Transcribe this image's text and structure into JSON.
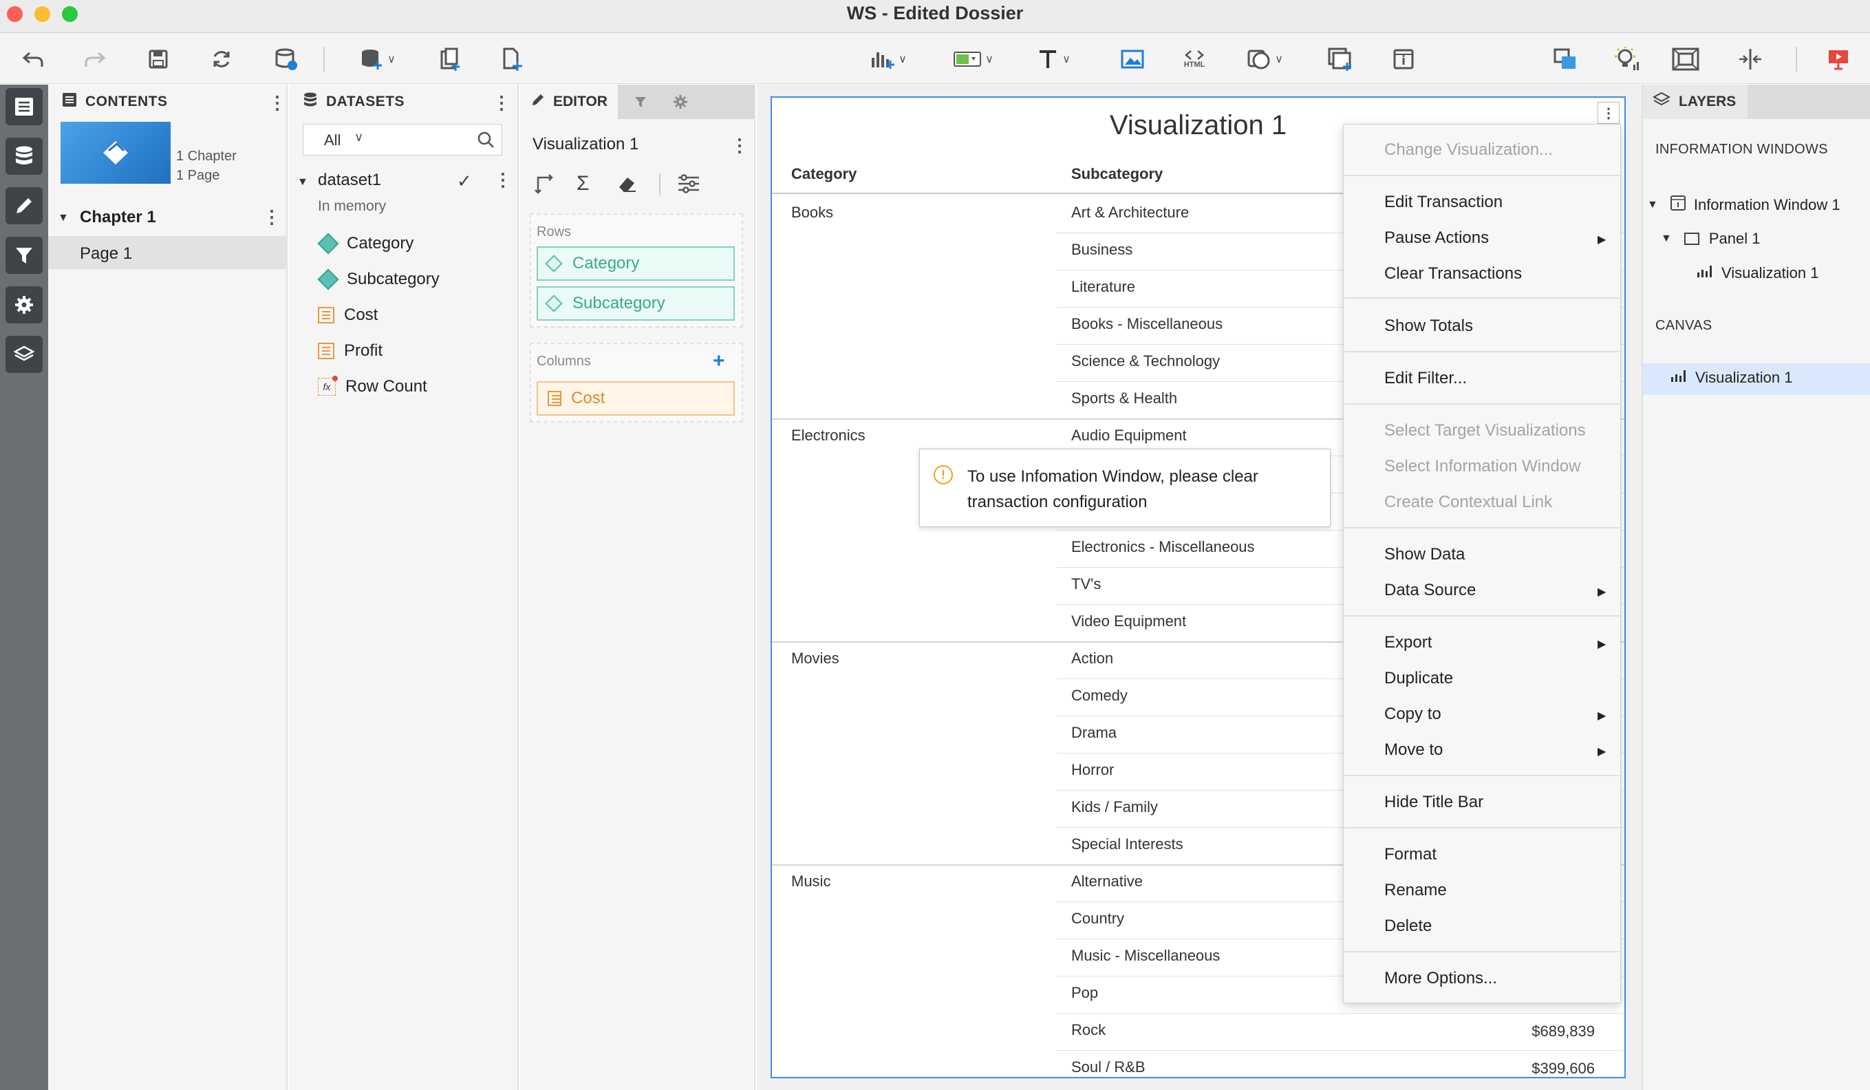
{
  "window": {
    "title": "WS - Edited Dossier"
  },
  "toolbar": {
    "icons": [
      "undo-icon",
      "redo-icon",
      "save-icon",
      "refresh-icon",
      "data-source-icon",
      "add-data-icon",
      "add-chapter-icon",
      "add-page-icon",
      "visualization-icon",
      "filter-selector-icon",
      "text-icon",
      "image-icon",
      "html-icon",
      "shape-icon",
      "panel-stack-icon",
      "information-window-icon",
      "layer-icon",
      "insights-icon",
      "fit-page-icon",
      "responsive-icon",
      "present-icon"
    ],
    "html_label": "HTML"
  },
  "contents": {
    "header": "CONTENTS",
    "meta_chapters": "1 Chapter",
    "meta_pages": "1 Page",
    "chapter": "Chapter 1",
    "page": "Page 1"
  },
  "datasets": {
    "header": "DATASETS",
    "filter_value": "All",
    "dataset_name": "dataset1",
    "dataset_status": "In memory",
    "items": [
      {
        "label": "Category",
        "kind": "attribute"
      },
      {
        "label": "Subcategory",
        "kind": "attribute"
      },
      {
        "label": "Cost",
        "kind": "metric"
      },
      {
        "label": "Profit",
        "kind": "metric"
      },
      {
        "label": "Row Count",
        "kind": "derived-metric"
      }
    ]
  },
  "editor": {
    "tab_label": "EDITOR",
    "viz_name": "Visualization 1",
    "rows_label": "Rows",
    "rows": [
      "Category",
      "Subcategory"
    ],
    "columns_label": "Columns",
    "columns": [
      "Cost"
    ]
  },
  "visualization": {
    "title": "Visualization 1",
    "headers": {
      "category": "Category",
      "subcategory": "Subcategory"
    },
    "groups": [
      {
        "category": "Books",
        "subcategories": [
          "Art & Architecture",
          "Business",
          "Literature",
          "Books - Miscellaneous",
          "Science & Technology",
          "Sports & Health"
        ]
      },
      {
        "category": "Electronics",
        "subcategories": [
          "Audio Equipment",
          "Electronics - Miscellaneous",
          "TV's",
          "Video Equipment"
        ]
      },
      {
        "category": "Movies",
        "subcategories": [
          "Action",
          "Comedy",
          "Drama",
          "Horror",
          "Kids / Family",
          "Special Interests"
        ]
      },
      {
        "category": "Music",
        "subcategories": [
          "Alternative",
          "Country",
          "Music - Miscellaneous",
          "Pop",
          "Rock",
          "Soul / R&B"
        ]
      }
    ],
    "visible_values": {
      "rock": "$689,839",
      "soul": "$399,606"
    }
  },
  "tooltip": {
    "icon": "warning-icon",
    "text": "To use Infomation Window, please clear transaction configuration"
  },
  "context_menu": {
    "items": [
      {
        "label": "Change Visualization...",
        "disabled": true
      },
      {
        "label": "Edit Transaction"
      },
      {
        "label": "Pause Actions",
        "submenu": true
      },
      {
        "label": "Clear Transactions"
      },
      {
        "label": "Show Totals"
      },
      {
        "label": "Edit Filter..."
      },
      {
        "label": "Select Target Visualizations",
        "disabled": true
      },
      {
        "label": "Select Information Window",
        "disabled": true
      },
      {
        "label": "Create Contextual Link",
        "disabled": true
      },
      {
        "label": "Show Data"
      },
      {
        "label": "Data Source",
        "submenu": true
      },
      {
        "label": "Export",
        "submenu": true
      },
      {
        "label": "Duplicate"
      },
      {
        "label": "Copy to",
        "submenu": true
      },
      {
        "label": "Move to",
        "submenu": true
      },
      {
        "label": "Hide Title Bar"
      },
      {
        "label": "Format"
      },
      {
        "label": "Rename"
      },
      {
        "label": "Delete"
      },
      {
        "label": "More Options..."
      }
    ]
  },
  "layers": {
    "header": "LAYERS",
    "info_windows_label": "INFORMATION WINDOWS",
    "info_window": "Information Window 1",
    "panel": "Panel 1",
    "panel_viz": "Visualization 1",
    "canvas_label": "CANVAS",
    "canvas_viz": "Visualization 1"
  },
  "colors": {
    "accent": "#3d8fe0",
    "attribute": "#5bc0b1",
    "metric": "#e79a3c",
    "rail": "#6a6f73",
    "present": "#e5483d"
  }
}
